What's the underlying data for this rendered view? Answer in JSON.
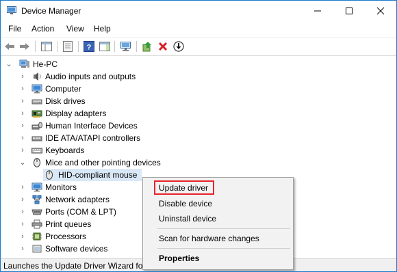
{
  "window": {
    "title": "Device Manager"
  },
  "menubar": {
    "items": [
      "File",
      "Action",
      "View",
      "Help"
    ]
  },
  "toolbar": {
    "icons": [
      "back-arrow-icon",
      "forward-arrow-icon",
      "show-hide-tree-icon",
      "properties-icon",
      "help-icon",
      "action-pane-icon",
      "scan-hardware-icon",
      "update-driver-icon",
      "uninstall-icon",
      "disable-device-icon"
    ],
    "colors": {
      "uninstall": "#d81f26",
      "update": "#2f9e3a"
    }
  },
  "tree": {
    "root": "He-PC",
    "items": [
      {
        "label": "Audio inputs and outputs",
        "icon": "speaker-icon"
      },
      {
        "label": "Computer",
        "icon": "monitor-icon"
      },
      {
        "label": "Disk drives",
        "icon": "disk-drive-icon"
      },
      {
        "label": "Display adapters",
        "icon": "display-adapter-icon"
      },
      {
        "label": "Human Interface Devices",
        "icon": "hid-icon"
      },
      {
        "label": "IDE ATA/ATAPI controllers",
        "icon": "ide-controller-icon"
      },
      {
        "label": "Keyboards",
        "icon": "keyboard-icon"
      },
      {
        "label": "Mice and other pointing devices",
        "icon": "mouse-icon",
        "expanded": true
      },
      {
        "label": "HID-compliant mouse",
        "icon": "mouse-icon",
        "child": true,
        "selected": true
      },
      {
        "label": "Monitors",
        "icon": "monitor-icon"
      },
      {
        "label": "Network adapters",
        "icon": "network-adapter-icon"
      },
      {
        "label": "Ports (COM & LPT)",
        "icon": "port-icon"
      },
      {
        "label": "Print queues",
        "icon": "printer-icon"
      },
      {
        "label": "Processors",
        "icon": "processor-icon"
      },
      {
        "label": "Software devices",
        "icon": "software-device-icon"
      }
    ]
  },
  "context_menu": {
    "items": [
      "Update driver",
      "Disable device",
      "Uninstall device",
      "Scan for hardware changes",
      "Properties"
    ],
    "highlighted": "Update driver",
    "highlight_color": "#e8212a"
  },
  "statusbar": {
    "text": "Launches the Update Driver Wizard for the selected device."
  }
}
